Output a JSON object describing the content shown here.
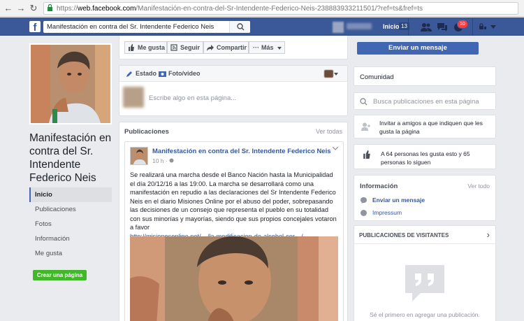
{
  "browser": {
    "url_scheme": "https://",
    "url_domain": "web.facebook.com",
    "url_path": "/Manifestación-en-contra-del-Sr-Intendente-Federico-Neis-238883933211501/?ref=ts&fref=ts"
  },
  "header": {
    "search_value": "Manifestación en contra del Sr. Intendente Federico Neis",
    "home_label": "Inicio",
    "home_count": "13",
    "notification_count": "10"
  },
  "sidebar": {
    "page_name": "Manifestación en contra del Sr. Intendente Federico Neis",
    "items": [
      {
        "label": "Inicio"
      },
      {
        "label": "Publicaciones"
      },
      {
        "label": "Fotos"
      },
      {
        "label": "Información"
      },
      {
        "label": "Me gusta"
      }
    ],
    "create_page_label": "Crear una página"
  },
  "actions": {
    "like": "Me gusta",
    "follow": "Seguir",
    "share": "Compartir",
    "more": "Más"
  },
  "composer": {
    "status_tab": "Estado",
    "photo_tab": "Foto/video",
    "placeholder": "Escribe algo en esta página..."
  },
  "posts": {
    "title": "Publicaciones",
    "see_all": "Ver todas",
    "post": {
      "author": "Manifestación en contra del Sr. Intendente Federico Neis",
      "time": "10 h ·",
      "text": "Se realizará una marcha desde el Banco Nación hasta la Municipalidad el día 20/12/16 a las 19:00. La marcha se desarrollará como una manifestación en repudio a las declaraciones del Sr Intendente Federico Neis en el diario Misiones Online por el abuso del poder, sobrepasando las decisiones de un consejo que representa el pueblo en su totalidad con sus minorías y mayorías, siendo que sus propios concejales votaron a favor",
      "link": "http://misionesonline.net/…/la-modificacion-de-alcohol-cer…/"
    }
  },
  "right": {
    "send_message": "Enviar un mensaje",
    "community": "Comunidad",
    "search_placeholder": "Busca publicaciones en esta página",
    "invite_text": "Invitar a amigos a que indiquen que les gusta la página",
    "likes_text": "A 64 personas les gusta esto y 65 personas lo siguen",
    "info_title": "Información",
    "info_see_all": "Ver todo",
    "info_message": "Enviar un mensaje",
    "info_impressum": "Impressum",
    "visitors_title": "PUBLICACIONES DE VISITANTES",
    "visitors_empty": "Sé el primero en agregar una publicación."
  },
  "colors": {
    "fb_blue": "#3b5998",
    "button_blue": "#4267b2",
    "green": "#42b72a",
    "background": "#e9ebee"
  }
}
